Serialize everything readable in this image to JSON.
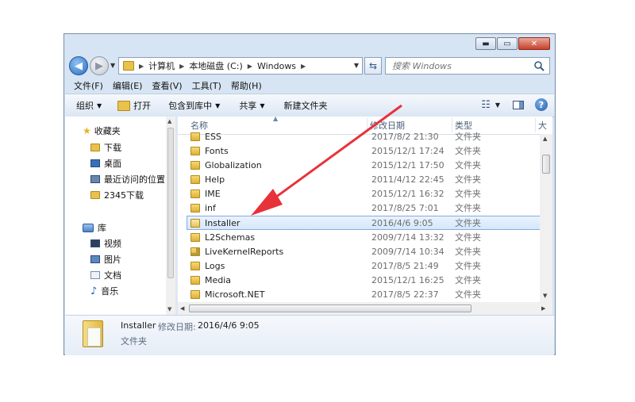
{
  "window": {
    "caption_minimize": "▬",
    "caption_maximize": "▭",
    "caption_close": "✕"
  },
  "address_bar": {
    "breadcrumbs": [
      "计算机",
      "本地磁盘 (C:)",
      "Windows"
    ]
  },
  "search": {
    "placeholder": "搜索 Windows"
  },
  "menu": [
    "文件(F)",
    "编辑(E)",
    "查看(V)",
    "工具(T)",
    "帮助(H)"
  ],
  "toolbar": {
    "organize": "组织",
    "open": "打开",
    "include_in_library": "包含到库中",
    "share": "共享",
    "new_folder": "新建文件夹"
  },
  "nav": {
    "favorites_title": "收藏夹",
    "favorites": [
      "下载",
      "桌面",
      "最近访问的位置",
      "2345下载"
    ],
    "libraries_title": "库",
    "libraries": [
      "视频",
      "图片",
      "文档",
      "音乐"
    ]
  },
  "columns": {
    "name": "名称",
    "date": "修改日期",
    "type": "类型",
    "extra": "大"
  },
  "files": [
    {
      "name": "ESS",
      "date": "2017/8/2 21:30",
      "type": "文件夹"
    },
    {
      "name": "Fonts",
      "date": "2015/12/1 17:24",
      "type": "文件夹"
    },
    {
      "name": "Globalization",
      "date": "2015/12/1 17:50",
      "type": "文件夹"
    },
    {
      "name": "Help",
      "date": "2011/4/12 22:45",
      "type": "文件夹"
    },
    {
      "name": "IME",
      "date": "2015/12/1 16:32",
      "type": "文件夹"
    },
    {
      "name": "inf",
      "date": "2017/8/25 7:01",
      "type": "文件夹"
    },
    {
      "name": "Installer",
      "date": "2016/4/6 9:05",
      "type": "文件夹",
      "selected": true
    },
    {
      "name": "L2Schemas",
      "date": "2009/7/14 13:32",
      "type": "文件夹"
    },
    {
      "name": "LiveKernelReports",
      "date": "2009/7/14 10:34",
      "type": "文件夹"
    },
    {
      "name": "Logs",
      "date": "2017/8/5 21:49",
      "type": "文件夹"
    },
    {
      "name": "Media",
      "date": "2015/12/1 16:25",
      "type": "文件夹"
    },
    {
      "name": "Microsoft.NET",
      "date": "2017/8/5 22:37",
      "type": "文件夹"
    }
  ],
  "details": {
    "name": "Installer",
    "date_label": "修改日期:",
    "date_value": "2016/4/6 9:05",
    "type": "文件夹"
  },
  "colors": {
    "annotation_arrow": "#e8323a",
    "selection": "#d5e7fb"
  }
}
